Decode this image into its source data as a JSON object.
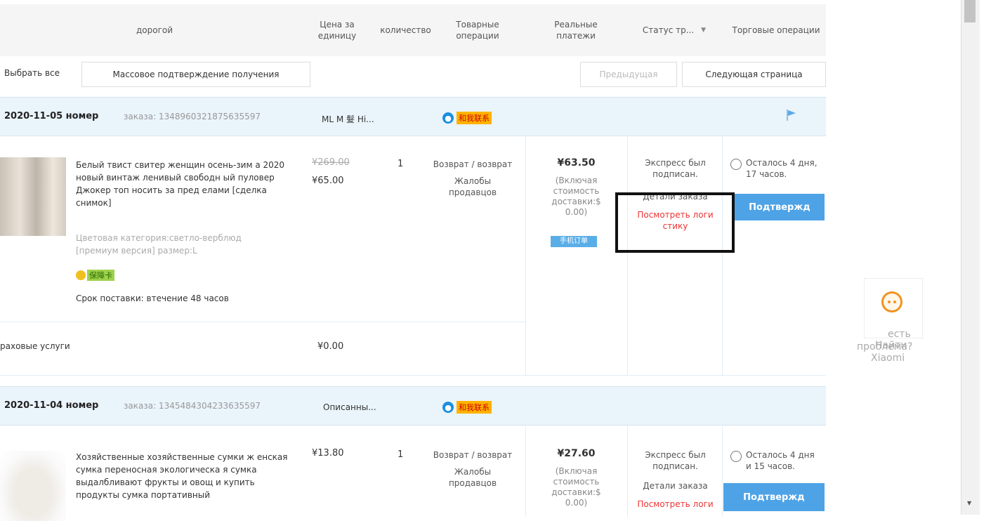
{
  "header": {
    "product": "дорогой",
    "unit_price": "Цена за единицу",
    "quantity": "количество",
    "goods_ops": "Товарные операции",
    "payments": "Реальные платежи",
    "status": "Статус тр...",
    "status_arrow": "▼",
    "trade_ops": "Торговые операции"
  },
  "toolbar": {
    "select_all": "Выбрать все",
    "bulk_confirm": "Массовое подтверждение получения",
    "prev": "Предыдущая",
    "next": "Следующая страница"
  },
  "orders": [
    {
      "date": "2020-11-05 номер",
      "order_label": "заказа: 1348960321875635597",
      "seller": "ML M 髮 Hi...",
      "contact": "和我联系",
      "title": "Белый твист свитер женщин осень-зим а 2020 новый винтаж ленивый свободн ый пуловер Джокер топ носить за пред елами [сделка снимок]",
      "attrs": "Цветовая категория:светло-верблюд [премиум версия]  размер:L",
      "badge": "保障卡",
      "delivery": "Срок поставки: втечение 48 часов",
      "old_price": "¥269.00",
      "price": "¥65.00",
      "qty": "1",
      "ops1": "Возврат / возврат",
      "ops2": "Жалобы продавцов",
      "total": "¥63.50",
      "shipping_note": "(Включая стоимость доставки:$ 0.00)",
      "pay_tag": "手机订单",
      "status1": "Экспресс был подписан.",
      "status_detail": "Детали заказа",
      "status_link": "Посмотреть логи стику",
      "timer": "Осталось 4 дня, 17 часов.",
      "confirm": "Подтвержд",
      "insurance": "раховые услуги",
      "insurance_price": "¥0.00"
    },
    {
      "date": "2020-11-04 номер",
      "order_label": "заказа: 1345484304233635597",
      "seller": "Описанны...",
      "contact": "和我联系",
      "title": "Хозяйственные хозяйственные сумки ж енская сумка переносная экологическа я сумка выдалбливают фрукты и овощ и купить продукты сумка портативный",
      "price": "¥13.80",
      "qty": "1",
      "ops1": "Возврат / возврат",
      "ops2": "Жалобы продавцов",
      "total": "¥27.60",
      "shipping_note": "(Включая стоимость доставки:$ 0.00)",
      "status1": "Экспресс был подписан.",
      "status_detail": "Детали заказа",
      "status_link": "Посмотреть логи",
      "timer": "Осталось 4 дня и 15 часов.",
      "confirm": "Подтвержд"
    }
  ],
  "helper": {
    "line1": "есть",
    "line2": "Найти",
    "line3": "проблема?",
    "line4": "Xiaomi"
  },
  "colors": {
    "accent": "#4ea3e6",
    "link_red": "#e33333",
    "order_header_bg": "#eaf4fb"
  }
}
